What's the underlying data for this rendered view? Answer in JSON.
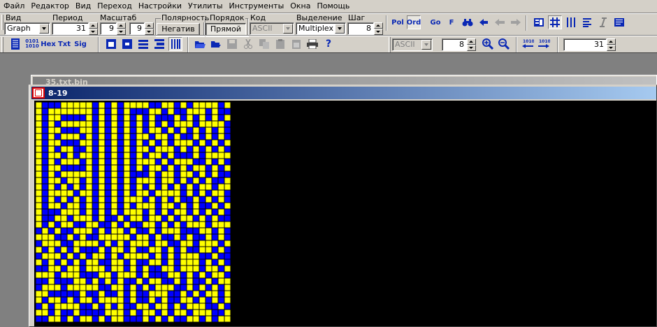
{
  "menu": [
    "Файл",
    "Редактор",
    "Вид",
    "Переход",
    "Настройки",
    "Утилиты",
    "Инструменты",
    "Окна",
    "Помощь"
  ],
  "toolbar1": {
    "view_label": "Вид",
    "view_value": "Graph",
    "period_label": "Период",
    "period_value": "31",
    "scale_label": "Масштаб",
    "scale_x": "9",
    "scale_y": "9",
    "polarity_label": "Полярность",
    "polarity_button": "Негатив",
    "order_label": "Порядок",
    "order_button": "Прямой",
    "code_label": "Код",
    "code_value": "ASCII",
    "selection_label": "Выделение",
    "selection_value": "Multiplex",
    "step_label": "Шаг",
    "step_value": "8",
    "pol_button": "Pol",
    "ord_button": "Ord",
    "go_button": "Go",
    "f_button": "F"
  },
  "toolbar2": {
    "fmt_buttons": [
      "0101\n1010",
      "Hex",
      "Txt",
      "Sig"
    ],
    "code2_value": "ASCII",
    "bits_value": "8",
    "period2_value": "31"
  },
  "back_window_title": "35.txt.bin",
  "window_title": "8-19",
  "colors": {
    "on": "#ffff00",
    "off": "#0000ff",
    "grid": "#000000",
    "bg": "#000000"
  },
  "bit_grid": {
    "cols": 31,
    "rows": [
      "1000111110101011110011010111101",
      "1011111110101010001101001110100",
      "1011000010101010101000101010101",
      "1010111110101010101010111011110",
      "1011000110101010101101010101010",
      "1010111010101010110110100101010",
      "1011000110101010101010111010101",
      "1010110010101010110111010101010",
      "1011010110101010101101000101111",
      "1010111010101010111010111001010",
      "1011000010101010101101010110101",
      "1010111110101010001011011010100",
      "1011011010101010111011010101001",
      "1010101010101010101010101011011",
      "1011110110101010110111101010110",
      "1010101010101011101010100101010",
      "1011011010101010111011010100101",
      "1000111010101011101010110101010",
      "1001101110100101101101011010100",
      "1010110011001010011010101110111",
      "0101001110101101001011100011010",
      "1110010100111110110100101001010",
      "0111001111010101110110011011101",
      "1010101000101101001101010011010",
      "0111010101101011110101011100100",
      "1010101011001101001101011101010",
      "0011011011101101010011011101101",
      "1110111000110111010001101010110",
      "0010001101010100101100101001011",
      "0111011111001101010111001010101",
      "1100000100100101001110010101101",
      "1011010110111101001010011010101",
      "0101111001010100110110101110010",
      "1101001000011101011010110111001",
      "0011010110101100010101001101011"
    ]
  }
}
